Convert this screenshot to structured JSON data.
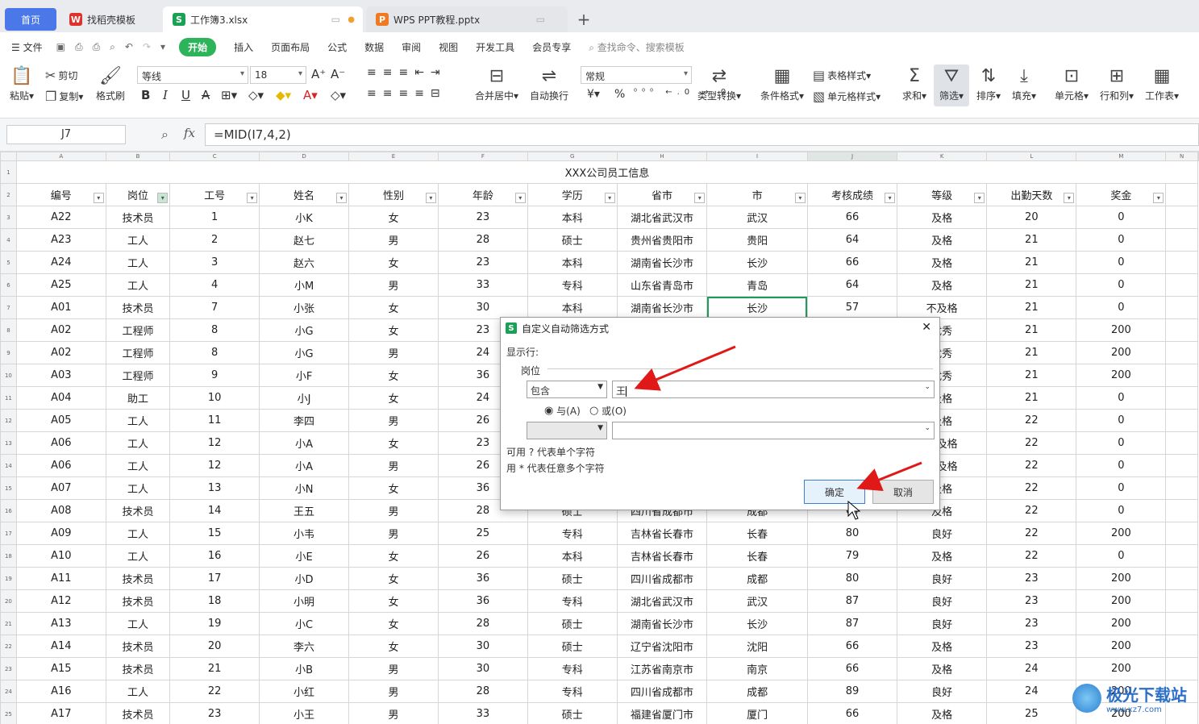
{
  "tabs": {
    "home": "首页",
    "t1": "找稻壳模板",
    "t2": "工作簿3.xlsx",
    "t3": "WPS PPT教程.pptx",
    "add": "+"
  },
  "menu": {
    "file": "文件",
    "items": [
      "开始",
      "插入",
      "页面布局",
      "公式",
      "数据",
      "审阅",
      "视图",
      "开发工具",
      "会员专享"
    ],
    "search": "查找命令、搜索模板"
  },
  "ribbon": {
    "paste": "粘贴",
    "cut": "剪切",
    "copy": "复制",
    "format_painter": "格式刷",
    "font": "等线",
    "size": "18",
    "merge": "合并居中",
    "wrap": "自动换行",
    "numfmt": "常规",
    "convert": "类型转换",
    "cond": "条件格式",
    "table_style": "表格样式",
    "cell_style": "单元格样式",
    "sum": "求和",
    "filter": "筛选",
    "sort": "排序",
    "fill": "填充",
    "cell": "单元格",
    "rowcol": "行和列",
    "sheet": "工作表",
    "percent": "%",
    "yen": "¥"
  },
  "formula": {
    "namebox": "J7",
    "fx": "fx",
    "text": "=MID(I7,4,2)"
  },
  "sheet": {
    "cols": [
      "A",
      "B",
      "C",
      "D",
      "E",
      "F",
      "G",
      "H",
      "I",
      "J",
      "K",
      "L",
      "M",
      "N"
    ],
    "title": "XXX公司员工信息",
    "headers": [
      "编号",
      "岗位",
      "工号",
      "姓名",
      "性别",
      "年龄",
      "学历",
      "省市",
      "市",
      "考核成绩",
      "等级",
      "出勤天数",
      "奖金"
    ],
    "rows": [
      [
        "A22",
        "技术员",
        "1",
        "小K",
        "女",
        "23",
        "本科",
        "湖北省武汉市",
        "武汉",
        "66",
        "及格",
        "20",
        "0"
      ],
      [
        "A23",
        "工人",
        "2",
        "赵七",
        "男",
        "28",
        "硕士",
        "贵州省贵阳市",
        "贵阳",
        "64",
        "及格",
        "21",
        "0"
      ],
      [
        "A24",
        "工人",
        "3",
        "赵六",
        "女",
        "23",
        "本科",
        "湖南省长沙市",
        "长沙",
        "66",
        "及格",
        "21",
        "0"
      ],
      [
        "A25",
        "工人",
        "4",
        "小M",
        "男",
        "33",
        "专科",
        "山东省青岛市",
        "青岛",
        "64",
        "及格",
        "21",
        "0"
      ],
      [
        "A01",
        "技术员",
        "7",
        "小张",
        "女",
        "30",
        "本科",
        "湖南省长沙市",
        "长沙",
        "57",
        "不及格",
        "21",
        "0"
      ],
      [
        "A02",
        "工程师",
        "8",
        "小G",
        "女",
        "23",
        "",
        "",
        "",
        "",
        "优秀",
        "21",
        "200"
      ],
      [
        "A02",
        "工程师",
        "8",
        "小G",
        "男",
        "24",
        "",
        "",
        "",
        "",
        "优秀",
        "21",
        "200"
      ],
      [
        "A03",
        "工程师",
        "9",
        "小F",
        "女",
        "36",
        "",
        "",
        "",
        "",
        "优秀",
        "21",
        "200"
      ],
      [
        "A04",
        "助工",
        "10",
        "小J",
        "女",
        "24",
        "",
        "",
        "",
        "",
        "及格",
        "21",
        "0"
      ],
      [
        "A05",
        "工人",
        "11",
        "李四",
        "男",
        "26",
        "",
        "",
        "",
        "",
        "及格",
        "22",
        "0"
      ],
      [
        "A06",
        "工人",
        "12",
        "小A",
        "女",
        "23",
        "",
        "",
        "",
        "",
        "不及格",
        "22",
        "0"
      ],
      [
        "A06",
        "工人",
        "12",
        "小A",
        "男",
        "26",
        "",
        "",
        "",
        "",
        "不及格",
        "22",
        "0"
      ],
      [
        "A07",
        "工人",
        "13",
        "小N",
        "女",
        "36",
        "",
        "",
        "",
        "",
        "及格",
        "22",
        "0"
      ],
      [
        "A08",
        "技术员",
        "14",
        "王五",
        "男",
        "28",
        "硕士",
        "四川省成都市",
        "成都",
        "64",
        "及格",
        "22",
        "0"
      ],
      [
        "A09",
        "工人",
        "15",
        "小韦",
        "男",
        "25",
        "专科",
        "吉林省长春市",
        "长春",
        "80",
        "良好",
        "22",
        "200"
      ],
      [
        "A10",
        "工人",
        "16",
        "小E",
        "女",
        "26",
        "本科",
        "吉林省长春市",
        "长春",
        "79",
        "及格",
        "22",
        "0"
      ],
      [
        "A11",
        "技术员",
        "17",
        "小D",
        "女",
        "36",
        "硕士",
        "四川省成都市",
        "成都",
        "80",
        "良好",
        "23",
        "200"
      ],
      [
        "A12",
        "技术员",
        "18",
        "小明",
        "女",
        "36",
        "专科",
        "湖北省武汉市",
        "武汉",
        "87",
        "良好",
        "23",
        "200"
      ],
      [
        "A13",
        "工人",
        "19",
        "小C",
        "女",
        "28",
        "硕士",
        "湖南省长沙市",
        "长沙",
        "87",
        "良好",
        "23",
        "200"
      ],
      [
        "A14",
        "技术员",
        "20",
        "李六",
        "女",
        "30",
        "硕士",
        "辽宁省沈阳市",
        "沈阳",
        "66",
        "及格",
        "23",
        "200"
      ],
      [
        "A15",
        "技术员",
        "21",
        "小B",
        "男",
        "30",
        "专科",
        "江苏省南京市",
        "南京",
        "66",
        "及格",
        "24",
        "200"
      ],
      [
        "A16",
        "工人",
        "22",
        "小红",
        "男",
        "28",
        "专科",
        "四川省成都市",
        "成都",
        "89",
        "良好",
        "24",
        "200"
      ],
      [
        "A17",
        "技术员",
        "23",
        "小王",
        "男",
        "33",
        "硕士",
        "福建省厦门市",
        "厦门",
        "66",
        "及格",
        "25",
        "200"
      ]
    ]
  },
  "dialog": {
    "title": "自定义自动筛选方式",
    "show_rows": "显示行:",
    "field": "岗位",
    "op1": "包含",
    "val1": "王",
    "and": "与(A)",
    "or": "或(O)",
    "op2": "",
    "val2": "",
    "hint1": "可用 ? 代表单个字符",
    "hint2": "用 * 代表任意多个字符",
    "ok": "确定",
    "cancel": "取消",
    "close": "✕"
  },
  "watermark": "极光下载站",
  "watermark_url": "www.xz7.com"
}
